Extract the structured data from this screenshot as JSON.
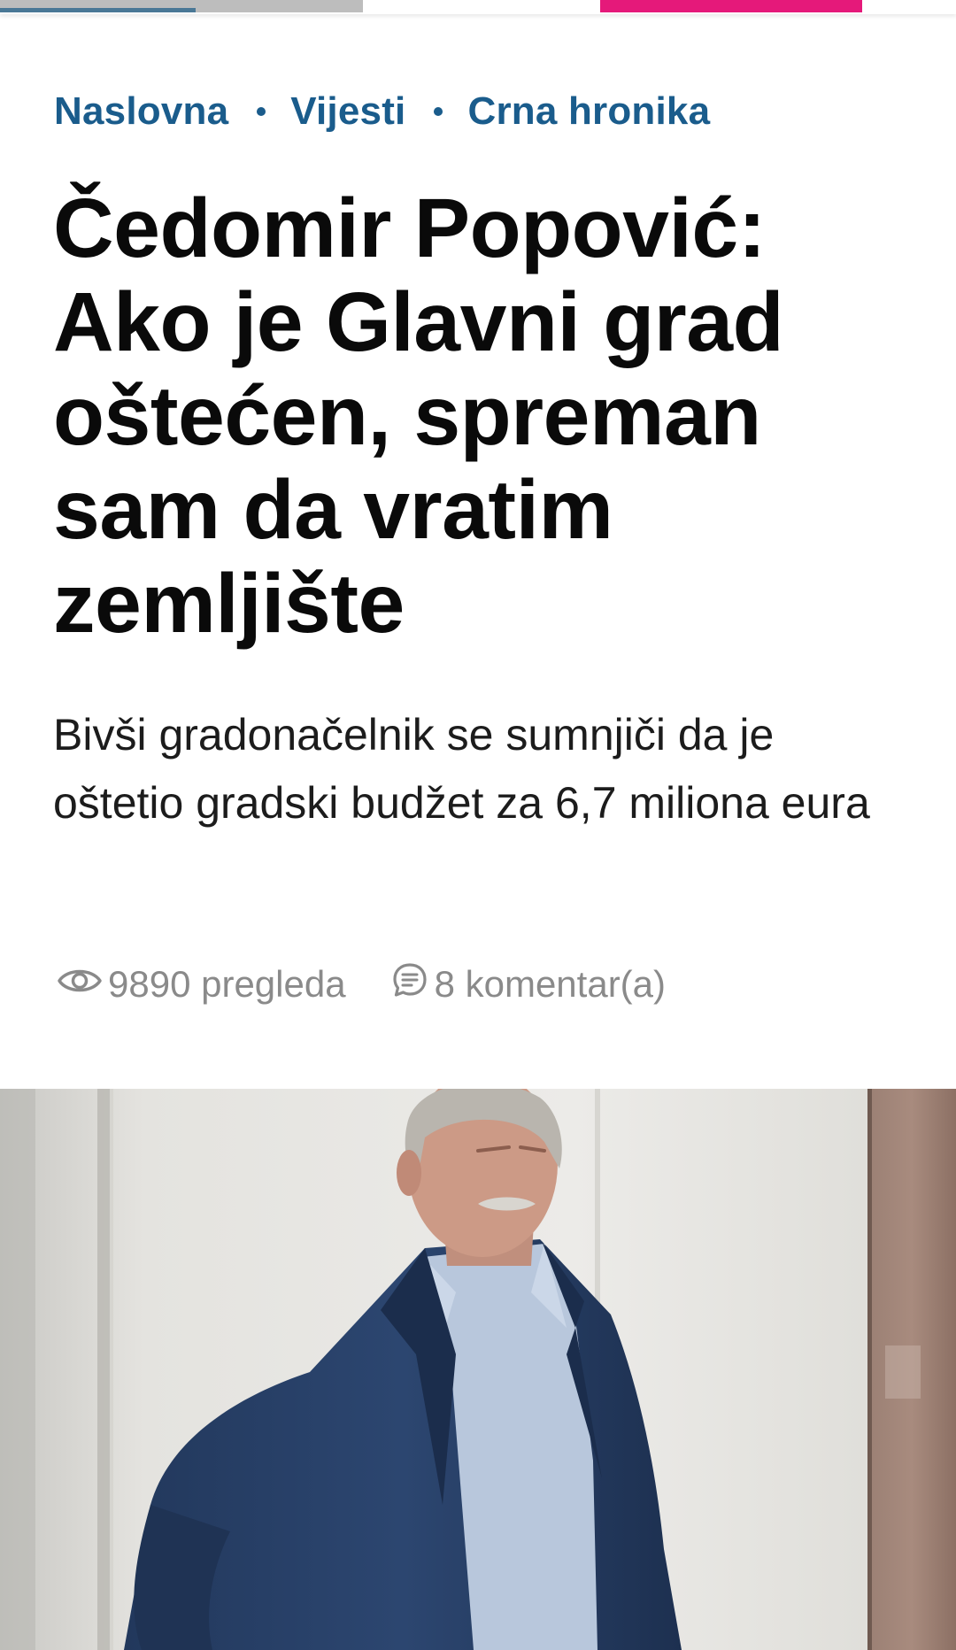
{
  "colors": {
    "brand_blue": "#1a5c8c",
    "accent_pink": "#e5197a",
    "title": "#0a0a0a",
    "meta": "#8a8a8a"
  },
  "breadcrumb": {
    "items": [
      {
        "label": "Naslovna"
      },
      {
        "label": "Vijesti"
      },
      {
        "label": "Crna hronika"
      }
    ]
  },
  "article": {
    "title": "Čedomir Popović: Ako je Glavni grad oštećen, spreman sam da vratim zemljište",
    "lead": "Bivši gradonačelnik se sumnjiči da je oštetio gradski budžet za 6,7 miliona eura",
    "views": "9890 pregleda",
    "comments": "8 komentar(a)",
    "views_icon": "eye-icon",
    "comments_icon": "comment-icon"
  }
}
